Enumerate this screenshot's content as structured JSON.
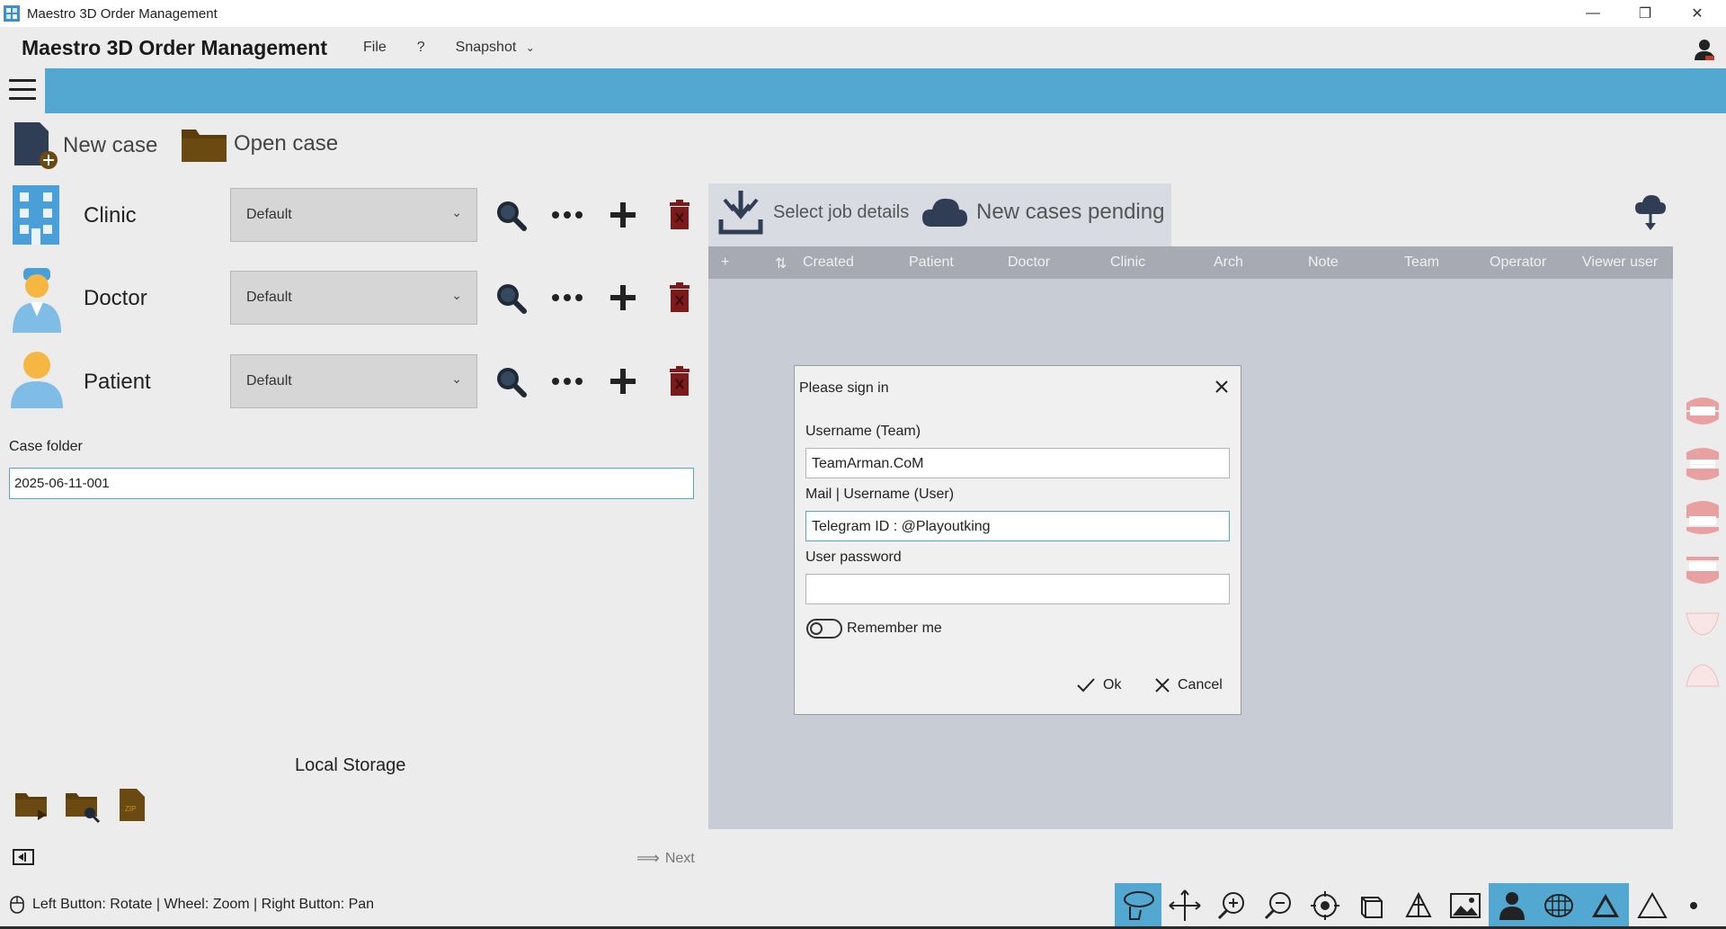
{
  "window": {
    "title": "Maestro 3D Order Management",
    "controls": [
      "minimize",
      "restore",
      "close"
    ]
  },
  "menubar": {
    "app_title": "Maestro 3D Order Management",
    "file": "File",
    "help": "?",
    "snapshot": "Snapshot"
  },
  "toolbar": {
    "new_case": "New case",
    "open_case": "Open case"
  },
  "entities": [
    {
      "label": "Clinic",
      "value": "Default"
    },
    {
      "label": "Doctor",
      "value": "Default"
    },
    {
      "label": "Patient",
      "value": "Default"
    }
  ],
  "case_folder": {
    "label": "Case folder",
    "value": "2025-06-11-001"
  },
  "local_storage": {
    "label": "Local Storage"
  },
  "next_label": "Next",
  "status": {
    "text": "Left Button: Rotate | Wheel: Zoom | Right Button: Pan"
  },
  "tabs": {
    "select_job": "Select job details",
    "new_cases": "New cases pending"
  },
  "table": {
    "columns": [
      "+",
      "Created",
      "Patient",
      "Doctor",
      "Clinic",
      "Arch",
      "Note",
      "Team",
      "Operator",
      "Viewer user"
    ]
  },
  "dialog": {
    "title": "Please sign in",
    "username_label": "Username (Team)",
    "username_value": "TeamArman.CoM",
    "mail_label": "Mail | Username (User)",
    "mail_value": "Telegram ID : @Playoutking",
    "password_label": "User password",
    "password_value": "",
    "remember_label": "Remember me",
    "ok_label": "Ok",
    "cancel_label": "Cancel"
  },
  "colors": {
    "accent_blue": "#53a8d2",
    "folder_brown": "#6b4a12",
    "trash_red": "#7a1a1a"
  }
}
